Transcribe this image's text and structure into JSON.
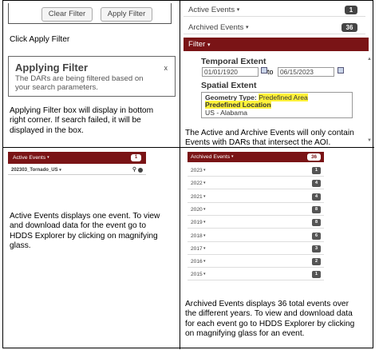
{
  "cell1": {
    "clear_filter": "Clear Filter",
    "apply_filter": "Apply Filter",
    "instruction": "Click Apply Filter",
    "applying_title": "Applying Filter",
    "applying_close": "x",
    "applying_body_1": "The DARs are being filtered based on",
    "applying_body_2": "your search parameters.",
    "caption_1": "Applying Filter box will display in bottom",
    "caption_2": "right corner.  If search failed, it will be",
    "caption_3": "displayed in the box."
  },
  "cell2": {
    "active_label": "Active Events",
    "active_count": "1",
    "archived_label": "Archived Events",
    "archived_count": "36",
    "filter_label": "Filter",
    "temporal_label": "Temporal Extent",
    "date_from": "01/01/1920",
    "date_to_word": "to",
    "date_to": "06/15/2023",
    "spatial_label": "Spatial Extent",
    "geom_label": "Geometry Type:",
    "geom_value": "Predefined Area",
    "predef_label": "Predefined Location",
    "location_value": "US - Alabama",
    "caption_1": "The Active and Archive Events will only contain",
    "caption_2": "Events with DARs that intersect the AOI."
  },
  "cell3": {
    "active_label": "Active Events",
    "active_count": "1",
    "event_name": "202303_Tornado_US",
    "caption_1": "Active Events displays one event.  To view",
    "caption_2": "and download data for the event go to",
    "caption_3": "HDDS Explorer by clicking on magnifying",
    "caption_4": "glass."
  },
  "cell4": {
    "archived_label": "Archived Events",
    "archived_count": "36",
    "years": [
      {
        "year": "2023",
        "count": "1"
      },
      {
        "year": "2022",
        "count": "4"
      },
      {
        "year": "2021",
        "count": "4"
      },
      {
        "year": "2020",
        "count": "8"
      },
      {
        "year": "2019",
        "count": "8"
      },
      {
        "year": "2018",
        "count": "6"
      },
      {
        "year": "2017",
        "count": "3"
      },
      {
        "year": "2016",
        "count": "2"
      },
      {
        "year": "2015",
        "count": "1"
      }
    ],
    "caption_1": "Archived Events displays 36 total events over",
    "caption_2": "the different years. To view and download data",
    "caption_3": "for each event go to HDDS Explorer by clicking",
    "caption_4": "on magnifying glass for an event."
  },
  "colors": {
    "maroon": "#7a1416",
    "badge": "#444444",
    "highlight": "#fff23a"
  },
  "icons": [
    "caret-icon",
    "calendar-icon",
    "magnifying-glass-icon",
    "info-icon",
    "scroll-up-icon",
    "scroll-down-icon"
  ]
}
